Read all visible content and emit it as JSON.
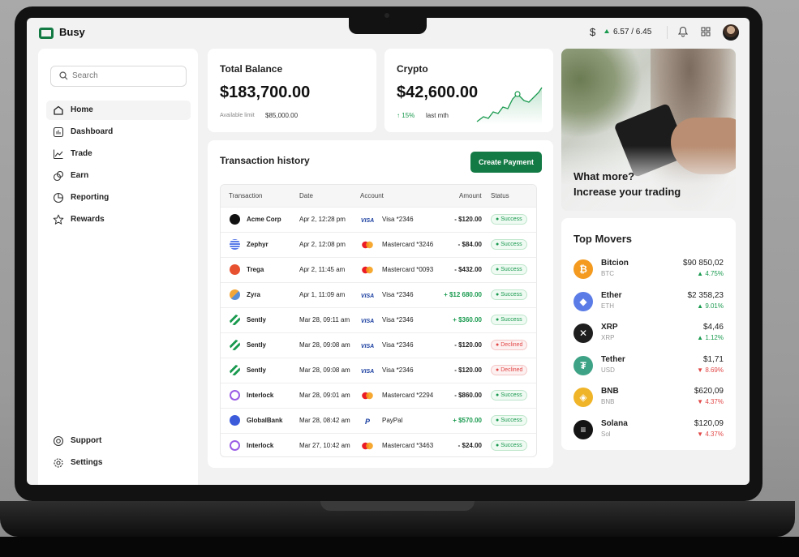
{
  "app": {
    "name": "Busy"
  },
  "topbar": {
    "currency_icon": "dollar-icon",
    "rate": "6.57 / 6.45",
    "rate_trend_color": "#1a9a4f"
  },
  "sidebar": {
    "search_placeholder": "Search",
    "items": [
      {
        "label": "Home",
        "icon": "home-icon",
        "active": true
      },
      {
        "label": "Dashboard",
        "icon": "dashboard-icon"
      },
      {
        "label": "Trade",
        "icon": "trade-icon"
      },
      {
        "label": "Earn",
        "icon": "earn-icon"
      },
      {
        "label": "Reporting",
        "icon": "reporting-icon"
      },
      {
        "label": "Rewards",
        "icon": "rewards-icon"
      }
    ],
    "footer_items": [
      {
        "label": "Support",
        "icon": "support-icon"
      },
      {
        "label": "Settings",
        "icon": "settings-icon"
      }
    ]
  },
  "balance": {
    "title": "Total Balance",
    "amount": "$183,700.00",
    "limit_label": "Available limit",
    "limit_value": "$85,000.00"
  },
  "crypto": {
    "title": "Crypto",
    "amount": "$42,600.00",
    "change": "↑ 15%",
    "period": "last mth",
    "accent": "#1a9a4f"
  },
  "promo": {
    "line1": "What more?",
    "line2": "Increase your trading"
  },
  "transactions": {
    "title": "Transaction history",
    "create_button": "Create Payment",
    "columns": [
      "Transaction",
      "Date",
      "Account",
      "Amount",
      "Status"
    ],
    "rows": [
      {
        "merchant": "Acme Corp",
        "date": "Apr 2, 12:28 pm",
        "card": "visa",
        "account": "Visa *2346",
        "amount": "- $120.00",
        "status": "Success"
      },
      {
        "merchant": "Zephyr",
        "date": "Apr 2, 12:08 pm",
        "card": "mastercard",
        "account": "Mastercard *3246",
        "amount": "- $84.00",
        "status": "Success"
      },
      {
        "merchant": "Trega",
        "date": "Apr 2, 11:45 am",
        "card": "mastercard",
        "account": "Mastercard *0093",
        "amount": "- $432.00",
        "status": "Success"
      },
      {
        "merchant": "Zyra",
        "date": "Apr 1, 11:09 am",
        "card": "visa",
        "account": "Visa *2346",
        "amount": "+ $12 680.00",
        "status": "Success"
      },
      {
        "merchant": "Sently",
        "date": "Mar 28, 09:11 am",
        "card": "visa",
        "account": "Visa *2346",
        "amount": "+ $360.00",
        "status": "Success"
      },
      {
        "merchant": "Sently",
        "date": "Mar 28, 09:08 am",
        "card": "visa",
        "account": "Visa *2346",
        "amount": "- $120.00",
        "status": "Declined"
      },
      {
        "merchant": "Sently",
        "date": "Mar 28, 09:08 am",
        "card": "visa",
        "account": "Visa *2346",
        "amount": "- $120.00",
        "status": "Declined"
      },
      {
        "merchant": "Interlock",
        "date": "Mar 28, 09:01 am",
        "card": "mastercard",
        "account": "Mastercard *2294",
        "amount": "- $860.00",
        "status": "Success"
      },
      {
        "merchant": "GlobalBank",
        "date": "Mar 28, 08:42 am",
        "card": "paypal",
        "account": "PayPal",
        "amount": "+ $570.00",
        "status": "Success"
      },
      {
        "merchant": "Interlock",
        "date": "Mar 27, 10:42 am",
        "card": "mastercard",
        "account": "Mastercard *3463",
        "amount": "- $24.00",
        "status": "Success"
      }
    ]
  },
  "movers": {
    "title": "Top Movers",
    "items": [
      {
        "name": "Bitcion",
        "symbol": "BTC",
        "price": "$90 850,02",
        "change": "▲ 4.75%",
        "positive": true,
        "color": "#f39a1f",
        "glyph": "₿"
      },
      {
        "name": "Ether",
        "symbol": "ETH",
        "price": "$2 358,23",
        "change": "▲ 9.01%",
        "positive": true,
        "color": "#5b7ce6",
        "glyph": "◆"
      },
      {
        "name": "XRP",
        "symbol": "XRP",
        "price": "$4,46",
        "change": "▲ 1.12%",
        "positive": true,
        "color": "#1e1e1e",
        "glyph": "✕"
      },
      {
        "name": "Tether",
        "symbol": "USD",
        "price": "$1,71",
        "change": "▼ 8.69%",
        "positive": false,
        "color": "#3ea386",
        "glyph": "₮"
      },
      {
        "name": "BNB",
        "symbol": "BNB",
        "price": "$620,09",
        "change": "▼ 4.37%",
        "positive": false,
        "color": "#f0b428",
        "glyph": "◈"
      },
      {
        "name": "Solana",
        "symbol": "Sol",
        "price": "$120,09",
        "change": "▼ 4.37%",
        "positive": false,
        "color": "#141414",
        "glyph": "≡"
      }
    ]
  }
}
